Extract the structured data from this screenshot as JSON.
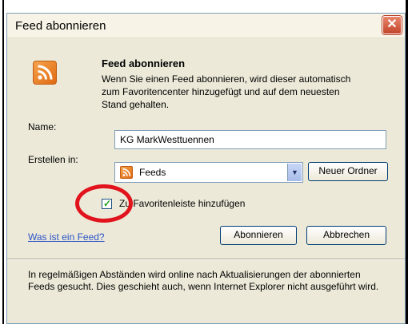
{
  "window": {
    "title": "Feed abonnieren",
    "close_glyph": "✕"
  },
  "header": {
    "heading": "Feed abonnieren",
    "description": "Wenn Sie einen Feed abonnieren, wird dieser automatisch zum Favoritencenter hinzugefügt und auf dem neuesten Stand gehalten.",
    "icon": "rss-feed-icon"
  },
  "form": {
    "name_label": "Name:",
    "name_value": "KG MarkWesttuennen",
    "create_in_label": "Erstellen in:",
    "create_in_value": "Feeds",
    "create_in_icon": "rss-feed-icon",
    "new_folder_label": "Neuer Ordner",
    "checkbox_label": "Zu Favoritenleiste hinzufügen",
    "checkbox_checked": true
  },
  "actions": {
    "help_link": "Was ist ein Feed?",
    "subscribe_label": "Abonnieren",
    "cancel_label": "Abbrechen"
  },
  "footer": {
    "info_text": "In regelmäßigen Abständen wird online nach Aktualisierungen der abonnierten Feeds gesucht. Dies geschieht auch, wenn Internet Explorer nicht ausgeführt wird."
  },
  "colors": {
    "highlight_circle": "#e1131d",
    "feed_orange": "#e06a12",
    "link_blue": "#2a54c7"
  }
}
